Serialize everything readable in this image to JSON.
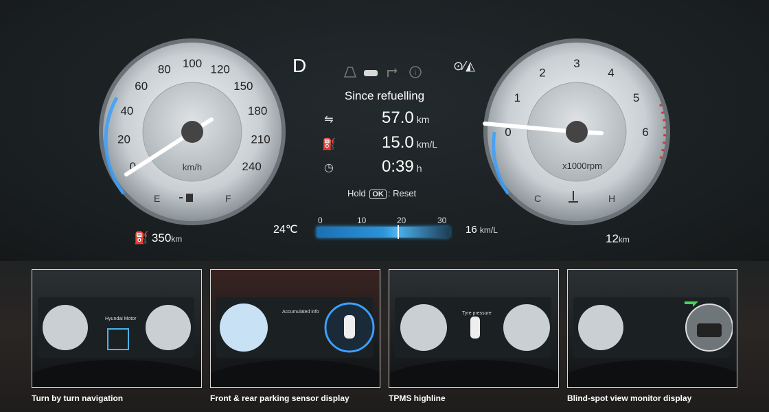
{
  "speedometer": {
    "ticks": [
      "0",
      "20",
      "40",
      "60",
      "80",
      "100",
      "120",
      "150",
      "180",
      "210",
      "240"
    ],
    "unit": "km/h",
    "fuel_empty": "E",
    "fuel_full": "F"
  },
  "tachometer": {
    "ticks": [
      "0",
      "1",
      "2",
      "3",
      "4",
      "5",
      "6"
    ],
    "unit": "x1000rpm",
    "temp_cold": "C",
    "temp_hot": "H"
  },
  "center": {
    "gear": "D",
    "title": "Since refuelling",
    "distance_value": "57.0",
    "distance_unit": "km",
    "efficiency_value": "15.0",
    "efficiency_unit": "km/L",
    "time_value": "0:39",
    "time_unit": "h",
    "reset_hold": "Hold",
    "reset_key": "OK",
    "reset_action": ": Reset"
  },
  "bottom_bar": {
    "temperature": "24℃",
    "eco_ticks": [
      "0",
      "10",
      "20",
      "30"
    ],
    "eco_level": 0.61,
    "eco_value": "16",
    "eco_unit": "km/L",
    "range_value": "350",
    "range_unit": "km",
    "trip_value": "12",
    "trip_unit": "km"
  },
  "thumbnails": [
    {
      "caption": "Turn by turn navigation",
      "inner_label": "Hyundai Motor"
    },
    {
      "caption": "Front & rear parking sensor display",
      "inner_label": "Accumulated info"
    },
    {
      "caption": "TPMS highline",
      "inner_label": "Tyre pressure"
    },
    {
      "caption": "Blind-spot view monitor display",
      "inner_label": ""
    }
  ],
  "icons": {
    "distance": "car-route-icon",
    "efficiency": "fuel-pump-icon",
    "time": "clock-icon",
    "lane_assist": "steering-lane-icon"
  }
}
